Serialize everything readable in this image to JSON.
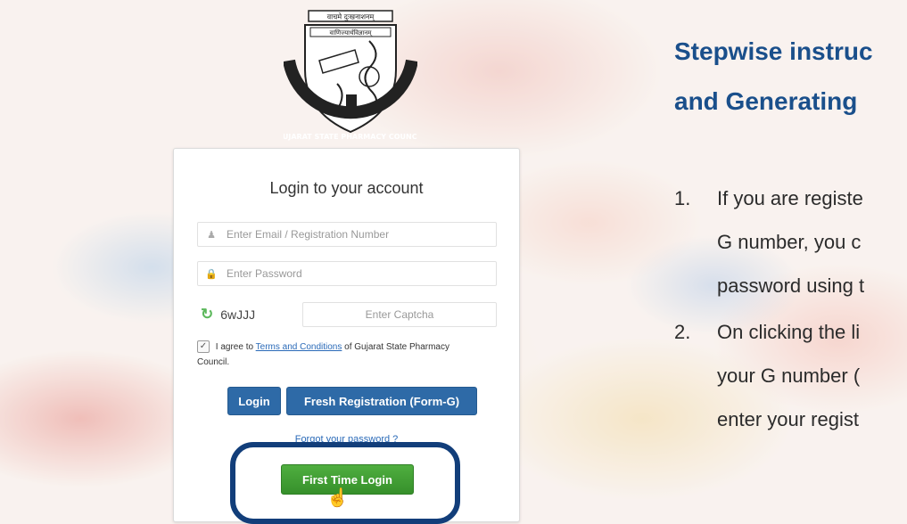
{
  "logo": {
    "top_text": "वाचमे दुःखनाशनम्",
    "sub_text": "वाणिज्यार्थविज्ञानम्",
    "ring_text": "GUJARAT STATE PHARMACY COUNCIL"
  },
  "login": {
    "title": "Login to your account",
    "email_placeholder": "Enter Email / Registration Number",
    "password_placeholder": "Enter Password",
    "captcha_code": "6wJJJ",
    "captcha_placeholder": "Enter Captcha",
    "agree_prefix": "I agree to",
    "terms_link": "Terms and Conditions",
    "agree_suffix": "of Gujarat State Pharmacy Council.",
    "login_button": "Login",
    "register_button": "Fresh Registration (Form-G)",
    "forgot_link": "Forgot your password ?",
    "first_time_button": "First Time Login"
  },
  "instructions": {
    "heading_line1": "Stepwise instruc",
    "heading_line2": "and Generating",
    "steps": [
      {
        "num": "1.",
        "lines": [
          "If you are registe",
          "G number, you c",
          "password using t"
        ]
      },
      {
        "num": "2.",
        "lines": [
          "On clicking the li",
          "your G number (",
          "enter your regist"
        ]
      }
    ]
  },
  "colors": {
    "heading": "#1a4f8b",
    "primary_button": "#2e6aa7",
    "success_button": "#3ea032",
    "highlight_ring": "#123e7a"
  },
  "icons": [
    "user-icon",
    "lock-icon",
    "refresh-icon",
    "checkbox-icon",
    "hand-cursor-icon"
  ]
}
